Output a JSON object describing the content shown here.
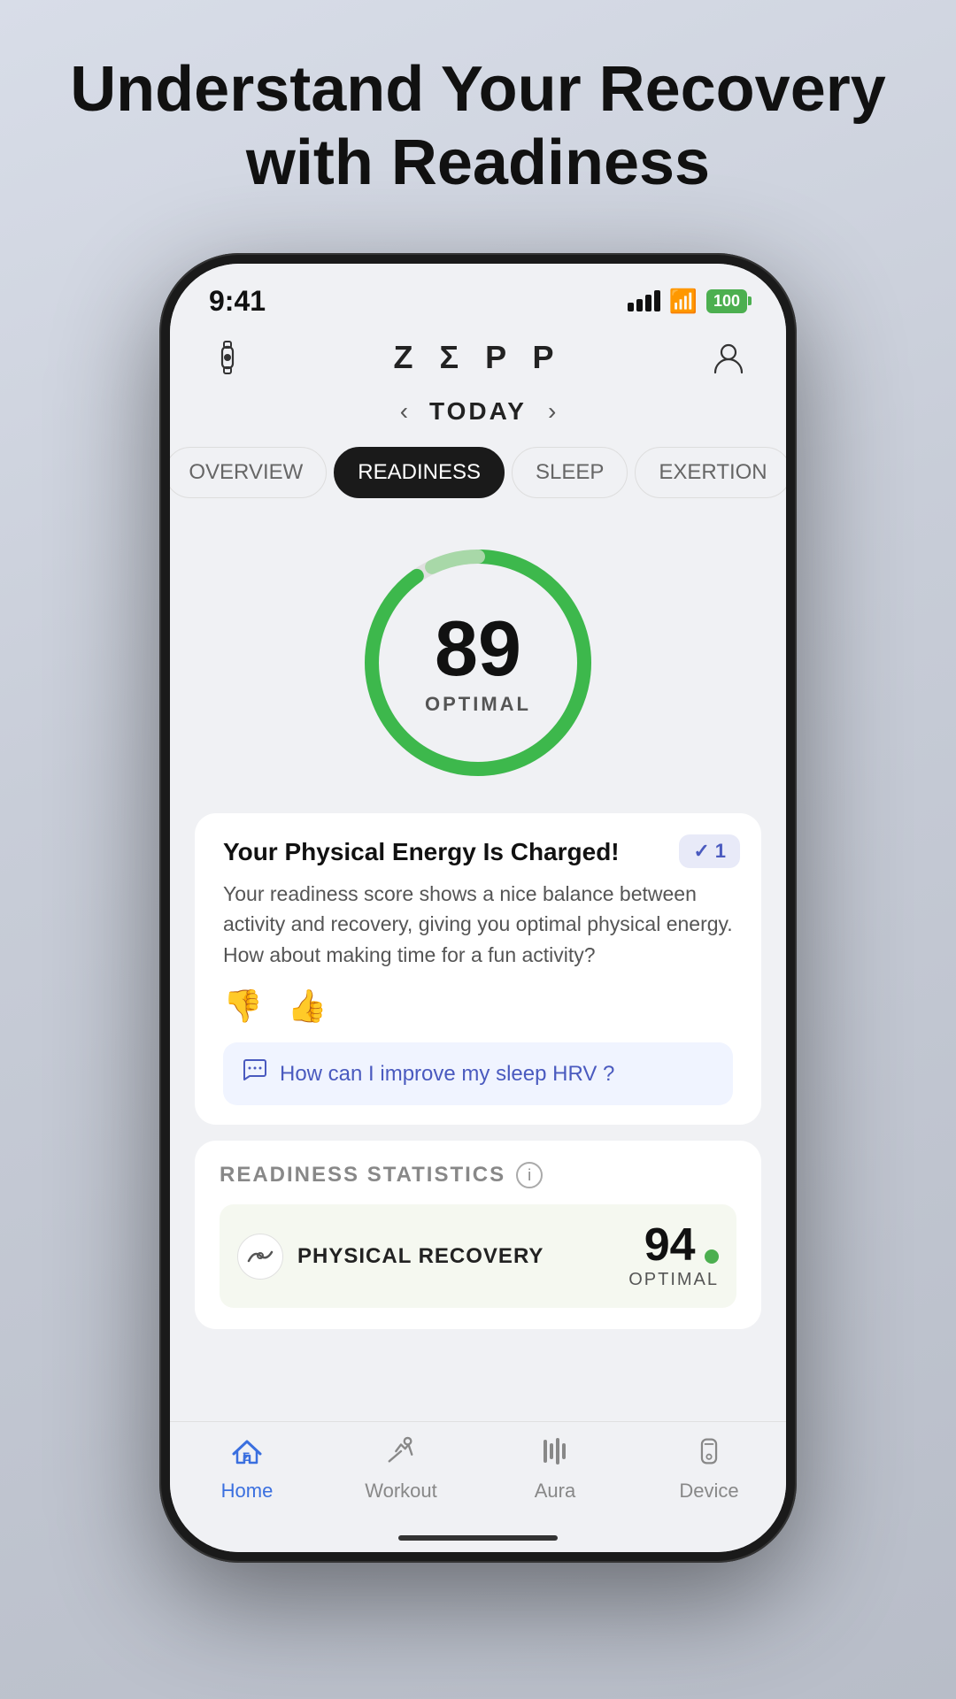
{
  "page": {
    "background_title_line1": "Understand Your Recovery",
    "background_title_line2": "with Readiness"
  },
  "status_bar": {
    "time": "9:41",
    "battery": "100"
  },
  "header": {
    "logo": "ZΕPP",
    "watch_icon": "⌚",
    "profile_icon": "👤"
  },
  "date_nav": {
    "label": "TODAY",
    "prev_arrow": "‹",
    "next_arrow": "›"
  },
  "tabs": [
    {
      "label": "OVERVIEW",
      "active": false
    },
    {
      "label": "READINESS",
      "active": true
    },
    {
      "label": "SLEEP",
      "active": false
    },
    {
      "label": "EXERTION",
      "active": false
    }
  ],
  "score_ring": {
    "value": "89",
    "label": "OPTIMAL",
    "progress_pct": 89,
    "color": "#3db84c"
  },
  "insight_card": {
    "badge_check": "✓",
    "badge_count": "1",
    "title": "Your Physical Energy Is Charged!",
    "body": "Your readiness score shows a nice balance between activity and recovery, giving you optimal physical energy. How about making time for a fun activity?",
    "thumbs_down": "👎",
    "thumbs_up": "👍",
    "ai_question": "How can I improve my sleep HRV ?"
  },
  "readiness_stats": {
    "section_title": "READINESS STATISTICS",
    "info_tooltip": "i",
    "rows": [
      {
        "icon": "〜",
        "name": "PHYSICAL RECOVERY",
        "value": "94",
        "dot_color": "#4CAF50",
        "sub_label": "OPTIMAL"
      }
    ]
  },
  "bottom_nav": {
    "items": [
      {
        "icon": "Σ",
        "label": "Home",
        "active": true
      },
      {
        "icon": "🏃",
        "label": "Workout",
        "active": false
      },
      {
        "icon": "|||",
        "label": "Aura",
        "active": false
      },
      {
        "icon": "⏱",
        "label": "Device",
        "active": false
      }
    ]
  }
}
